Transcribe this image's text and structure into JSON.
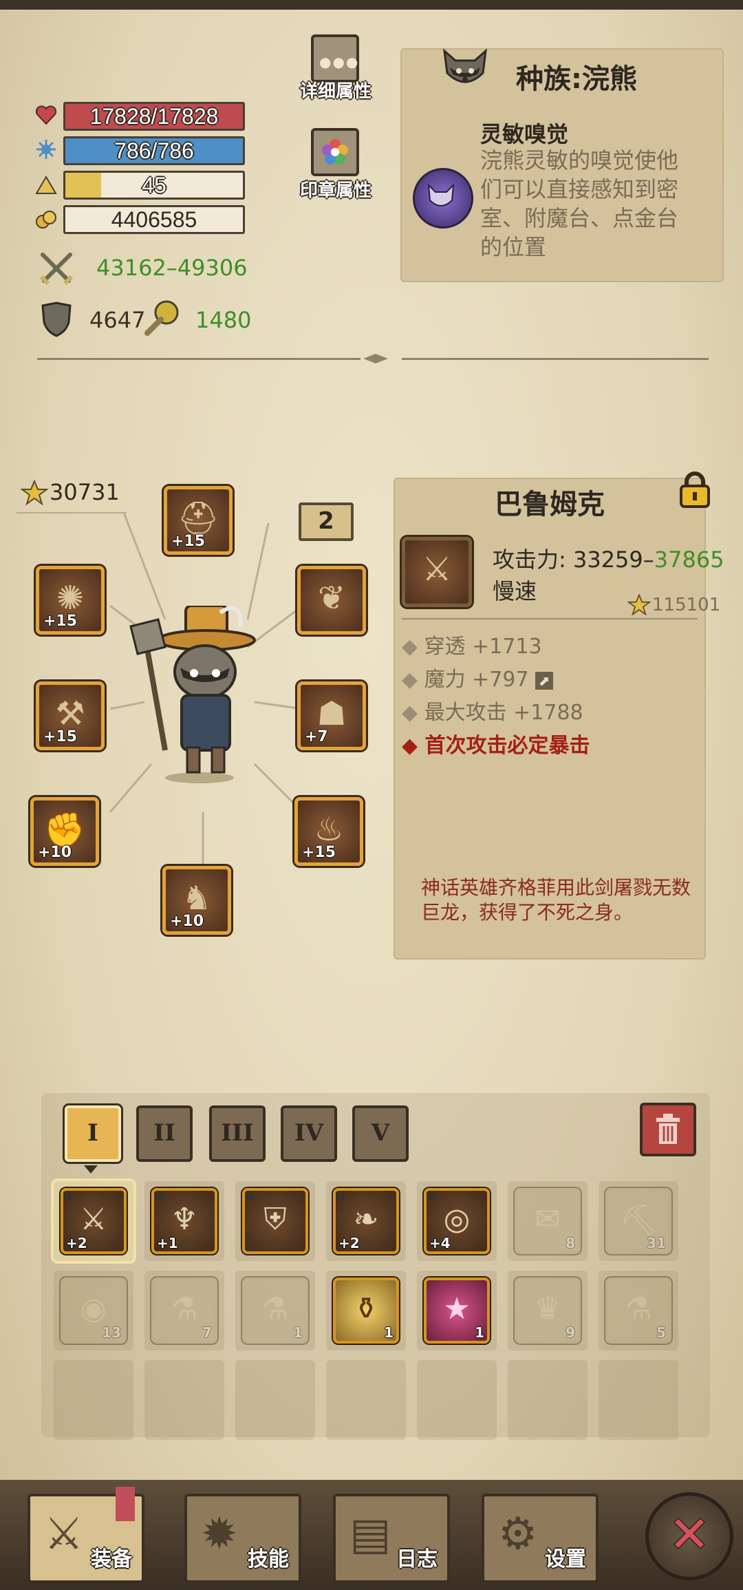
{
  "stats": {
    "hp": "17828/17828",
    "hp_fraction": 1.0,
    "mp": "786/786",
    "mp_fraction": 1.0,
    "level": "45",
    "level_fraction": 0.2,
    "gold": "4406585",
    "attack_min": "43162",
    "attack_dash": "–",
    "attack_max": "49306",
    "defense": "4647",
    "resist": "1480"
  },
  "buttons": {
    "detail_attrs": "详细属性",
    "seal_attrs": "印章属性"
  },
  "race": {
    "title": "种族:浣熊",
    "trait_name": "灵敏嗅觉",
    "trait_desc": "浣熊灵敏的嗅觉使他们可以直接感知到密室、附魔台、点金台的位置"
  },
  "character": {
    "power": "30731",
    "badge": "2"
  },
  "equipment_slots": [
    {
      "id": "hat",
      "plus": "+15"
    },
    {
      "id": "head",
      "plus": "+15"
    },
    {
      "id": "bat-amulet",
      "plus": ""
    },
    {
      "id": "weapon",
      "plus": "+15"
    },
    {
      "id": "armor",
      "plus": "+7"
    },
    {
      "id": "gauntlet",
      "plus": "+10"
    },
    {
      "id": "boots",
      "plus": "+15"
    },
    {
      "id": "legs",
      "plus": "+10"
    }
  ],
  "item_detail": {
    "name": "巴鲁姆克",
    "attack_label": "攻击力: ",
    "attack_min": "33259",
    "attack_dash": "–",
    "attack_max": "37865",
    "speed": "慢速",
    "score": "115101",
    "attrs": [
      "穿透 +1713",
      "魔力 +797",
      "最大攻击 +1788"
    ],
    "special": "首次攻击必定暴击",
    "lore": "神话英雄齐格菲用此剑屠戮无数巨龙，获得了不死之身。"
  },
  "tabs": [
    "I",
    "II",
    "III",
    "IV",
    "V"
  ],
  "inventory_row1": [
    {
      "plus": "+2",
      "count": "",
      "faded": false,
      "locked": true
    },
    {
      "plus": "+1",
      "count": "",
      "faded": false,
      "locked": true
    },
    {
      "plus": "",
      "count": "",
      "faded": false,
      "locked": true
    },
    {
      "plus": "+2",
      "count": "",
      "faded": false,
      "locked": true
    },
    {
      "plus": "+4",
      "count": "",
      "faded": false,
      "locked": true
    },
    {
      "plus": "",
      "count": "8",
      "faded": true,
      "locked": false
    },
    {
      "plus": "",
      "count": "31",
      "faded": true,
      "locked": false
    }
  ],
  "inventory_row2": [
    {
      "count": "13",
      "faded": true
    },
    {
      "count": "7",
      "faded": true
    },
    {
      "count": "1",
      "faded": true
    },
    {
      "count": "1",
      "faded": false
    },
    {
      "count": "1",
      "faded": false
    },
    {
      "count": "9",
      "faded": true
    },
    {
      "count": "5",
      "faded": true
    }
  ],
  "nav": {
    "equip": "装备",
    "skills": "技能",
    "log": "日志",
    "settings": "设置"
  },
  "colors": {
    "hp_bar": "#c04b4f",
    "mp_bar": "#4d8fc6",
    "xp_bar": "#e3c255",
    "green_text": "#3d8f26",
    "special_red": "#a41f16"
  }
}
